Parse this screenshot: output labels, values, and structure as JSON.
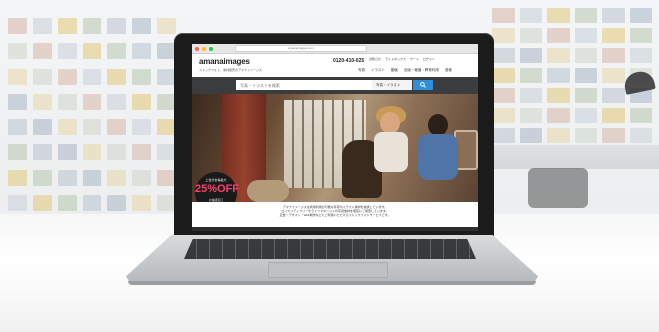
{
  "browser": {
    "url": "amanaimages.com",
    "traffic_lights": [
      "#ff5f57",
      "#febc2e",
      "#28c840"
    ]
  },
  "site": {
    "logo": "amanaimages",
    "tagline": "ストックフォト、素材販売のアマナイメージズ",
    "phone": "0120-410-025",
    "top_links": [
      "お知らせ",
      "ライトボックス",
      "カート",
      "ログイン"
    ],
    "nav": [
      "写真",
      "イラスト",
      "動画",
      "出版・報道・教育利用",
      "音楽"
    ]
  },
  "search": {
    "placeholder": "写真・イラストを検索",
    "category": "写真・イラスト"
  },
  "promo": {
    "line1": "上位がお得最大",
    "big": "25%OFF",
    "line3": "お電話窓口",
    "line4": "0120-410-025"
  },
  "intro": {
    "line1": "アマナイメージズは商用利用が可能な写真やイラスト素材を提供しています。",
    "line2": "ロイヤリティフリーやライツマネージドの写真素材を豊富にご用意しています。",
    "line3": "広告・デザイン・Web制作などにご利用いただけるストックフォトサービスです。"
  },
  "colors": {
    "search_button": "#2f8fd8",
    "search_bar": "#3a3c3e",
    "promo_accent": "#ff3d6e"
  }
}
